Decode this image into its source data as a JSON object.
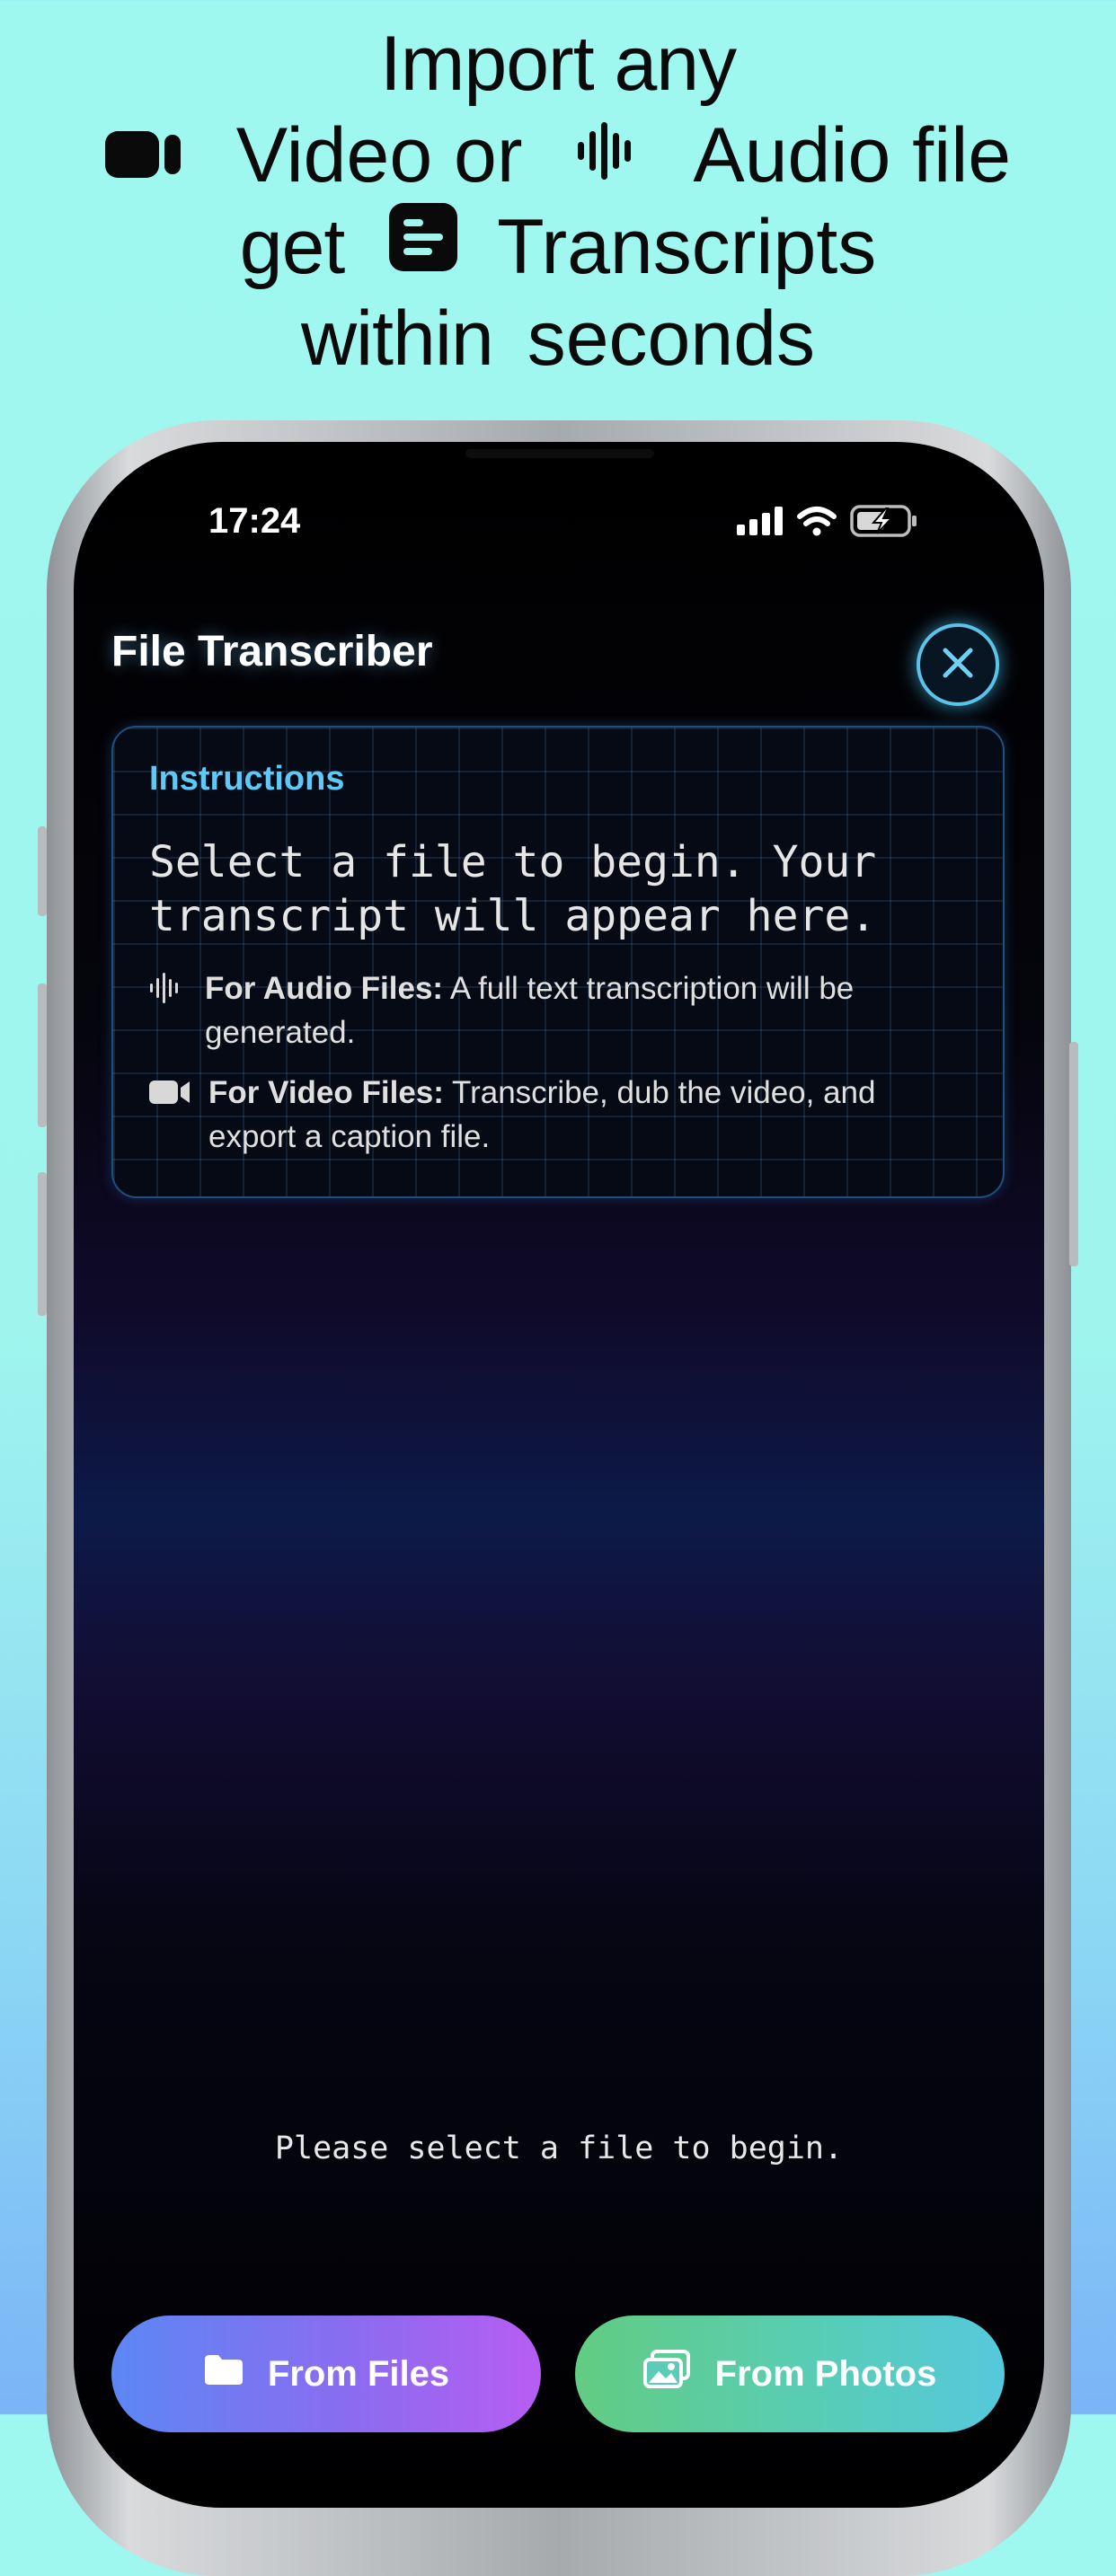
{
  "headline": {
    "line1": "Import any",
    "video_word": "Video or",
    "audio_word": "Audio file",
    "get_word": "get",
    "transcripts_word": "Transcripts",
    "within_word": "within",
    "seconds_word": "seconds"
  },
  "status_bar": {
    "time": "17:24"
  },
  "app": {
    "title": "File Transcriber"
  },
  "instructions": {
    "heading": "Instructions",
    "main_text": "Select a file to begin. Your transcript will appear here.",
    "audio_label": "For Audio Files:",
    "audio_text": " A full text transcription will be generated.",
    "video_label": "For Video Files:",
    "video_text": " Transcribe, dub the video, and export a caption file."
  },
  "placeholder": "Please select a file to begin.",
  "buttons": {
    "files_label": "From Files",
    "photos_label": "From Photos"
  },
  "colors": {
    "background": "#9ff8ef",
    "accent_cyan": "#5ec8f6",
    "files_button": "#8a6cf0",
    "photos_button": "#58cdb4"
  },
  "icons": [
    "video-camera-icon",
    "waveform-icon",
    "document-lines-icon",
    "close-icon",
    "folder-icon",
    "photos-icon",
    "cellular-signal-icon",
    "wifi-icon",
    "battery-charging-icon"
  ]
}
